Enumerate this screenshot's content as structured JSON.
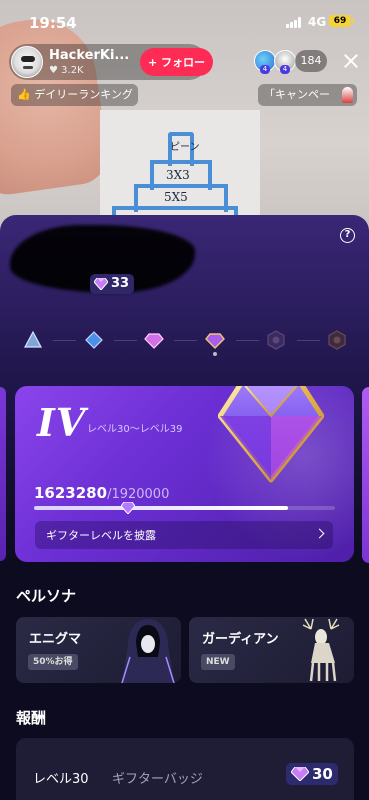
{
  "status_bar": {
    "time": "19:54",
    "network": "4G",
    "battery": "69"
  },
  "host": {
    "name": "HackerKi...",
    "likes": "3.2K",
    "follow_label": "+ フォロー"
  },
  "viewers": {
    "badges": [
      "4",
      "4"
    ],
    "count": "184"
  },
  "chips": {
    "daily_ranking": "デイリーランキング",
    "campaign": "「キャンペー"
  },
  "stream_paper": {
    "row1": "ピーン",
    "row2": "3X3",
    "row3": "5X5"
  },
  "sheet": {
    "help_label": "?",
    "level_chip": "33",
    "tiers": [
      "tier-1",
      "tier-2",
      "tier-3",
      "tier-4",
      "tier-5",
      "tier-6"
    ],
    "card": {
      "roman": "IV",
      "range": "レベル30〜レベル39",
      "current": "1623280",
      "total": "/1920000",
      "progress": 0.845,
      "show_button": "ギフターレベルを披露"
    },
    "persona_title": "ペルソナ",
    "personas": [
      {
        "name": "エニグマ",
        "badge": "50%お得"
      },
      {
        "name": "ガーディアン",
        "badge": "NEW"
      }
    ],
    "reward_title": "報酬",
    "reward": {
      "level": "レベル30",
      "name": "ギフターバッジ",
      "value": "30"
    }
  },
  "colors": {
    "follow": "#fe2c55",
    "accent": "#7b3ae0",
    "battery": "#f4d23a"
  }
}
